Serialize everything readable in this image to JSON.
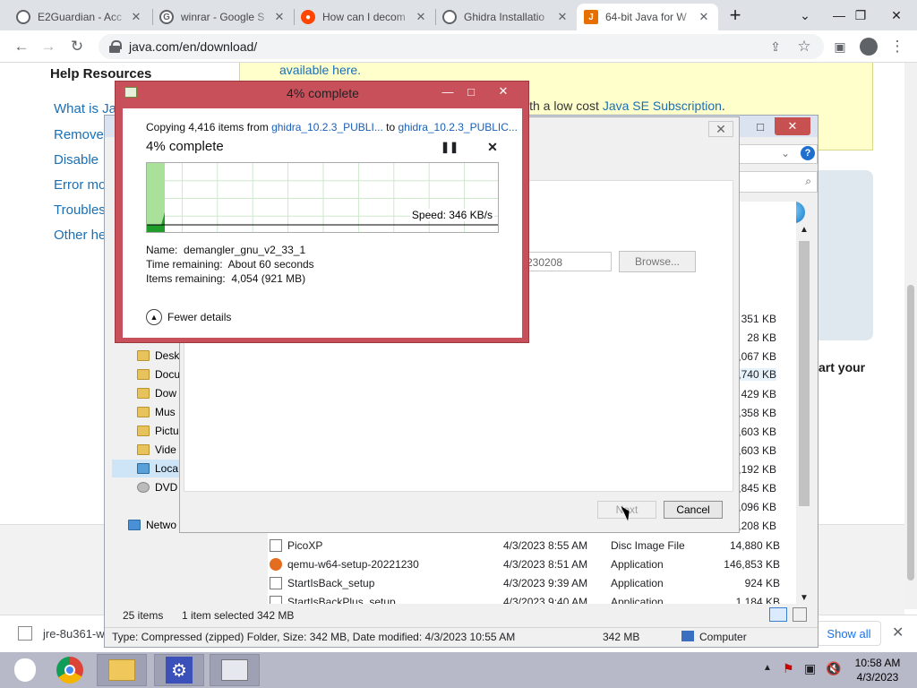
{
  "browser": {
    "tabs": [
      {
        "title": "E2Guardian - Acc",
        "icon": "e2guardian-icon",
        "color": "#5f6368"
      },
      {
        "title": "winrar - Google S",
        "icon": "google-icon",
        "color": "#4285f4"
      },
      {
        "title": "How can I decom",
        "icon": "reddit-icon",
        "color": "#ff4500"
      },
      {
        "title": "Ghidra Installatio",
        "icon": "github-icon",
        "color": "#24292f"
      },
      {
        "title": "64-bit Java for W",
        "icon": "java-icon",
        "color": "#e76f00"
      }
    ],
    "new_tab": "+",
    "url": "java.com/en/download/"
  },
  "webpage": {
    "help_title": "Help Resources",
    "help_links": [
      "What is Ja",
      "Remove",
      "Disable",
      "Error mo",
      "Troubles",
      "Other he"
    ],
    "available_text": "available here.",
    "subscription_prefix": "ith a low cost ",
    "subscription_link": "Java SE Subscription",
    "subscription_suffix": ".",
    "start_your": "art your"
  },
  "download_shelf": {
    "file": "jre-8u361-w",
    "show_all": "Show all"
  },
  "explorer": {
    "nav_items": [
      "Desk",
      "Docu",
      "Dow",
      "Mus",
      "Pictu",
      "Vide",
      "Loca",
      "DVD"
    ],
    "network": "Netwo",
    "sizes_partial": [
      "351 KB",
      "28 KB",
      "0,067 KB",
      "0,740 KB",
      "429 KB",
      "0,358 KB",
      "3,603 KB",
      "3,603 KB",
      "3,192 KB",
      "9,845 KB",
      "3,096 KB",
      "7,208 KB"
    ],
    "rows": [
      {
        "name": "PicoXP",
        "date": "4/3/2023 8:55 AM",
        "type": "Disc Image File",
        "size": "14,880 KB"
      },
      {
        "name": "qemu-w64-setup-20221230",
        "date": "4/3/2023 8:51 AM",
        "type": "Application",
        "size": "146,853 KB"
      },
      {
        "name": "StartIsBack_setup",
        "date": "4/3/2023 9:39 AM",
        "type": "Application",
        "size": "924 KB"
      },
      {
        "name": "StartIsBackPlus_setup",
        "date": "4/3/2023 9:40 AM",
        "type": "Application",
        "size": "1,184 KB"
      }
    ],
    "status": {
      "items": "25 items",
      "selected": "1 item selected",
      "selected_size": "342 MB",
      "details": "Type: Compressed (zipped) Folder, Size: 342 MB, Date modified: 4/3/2023 10:55 AM",
      "size2": "342 MB",
      "location": "Computer"
    }
  },
  "wizard": {
    "path_value": "230208",
    "browse": "Browse...",
    "next": "Next",
    "cancel": "Cancel"
  },
  "copy_dialog": {
    "title": "4% complete",
    "copying_prefix": "Copying 4,416 items from ",
    "source": "ghidra_10.2.3_PUBLI...",
    "to": " to ",
    "dest": "ghidra_10.2.3_PUBLIC...",
    "percent_label": "4% complete",
    "progress_percent": 4,
    "speed": "Speed: 346 KB/s",
    "name_label": "Name:",
    "name_value": "demangler_gnu_v2_33_1",
    "time_label": "Time remaining:",
    "time_value": "About 60 seconds",
    "items_label": "Items remaining:",
    "items_value": "4,054 (921 MB)",
    "fewer_details": "Fewer details"
  },
  "taskbar": {
    "time": "10:58 AM",
    "date": "4/3/2023"
  }
}
